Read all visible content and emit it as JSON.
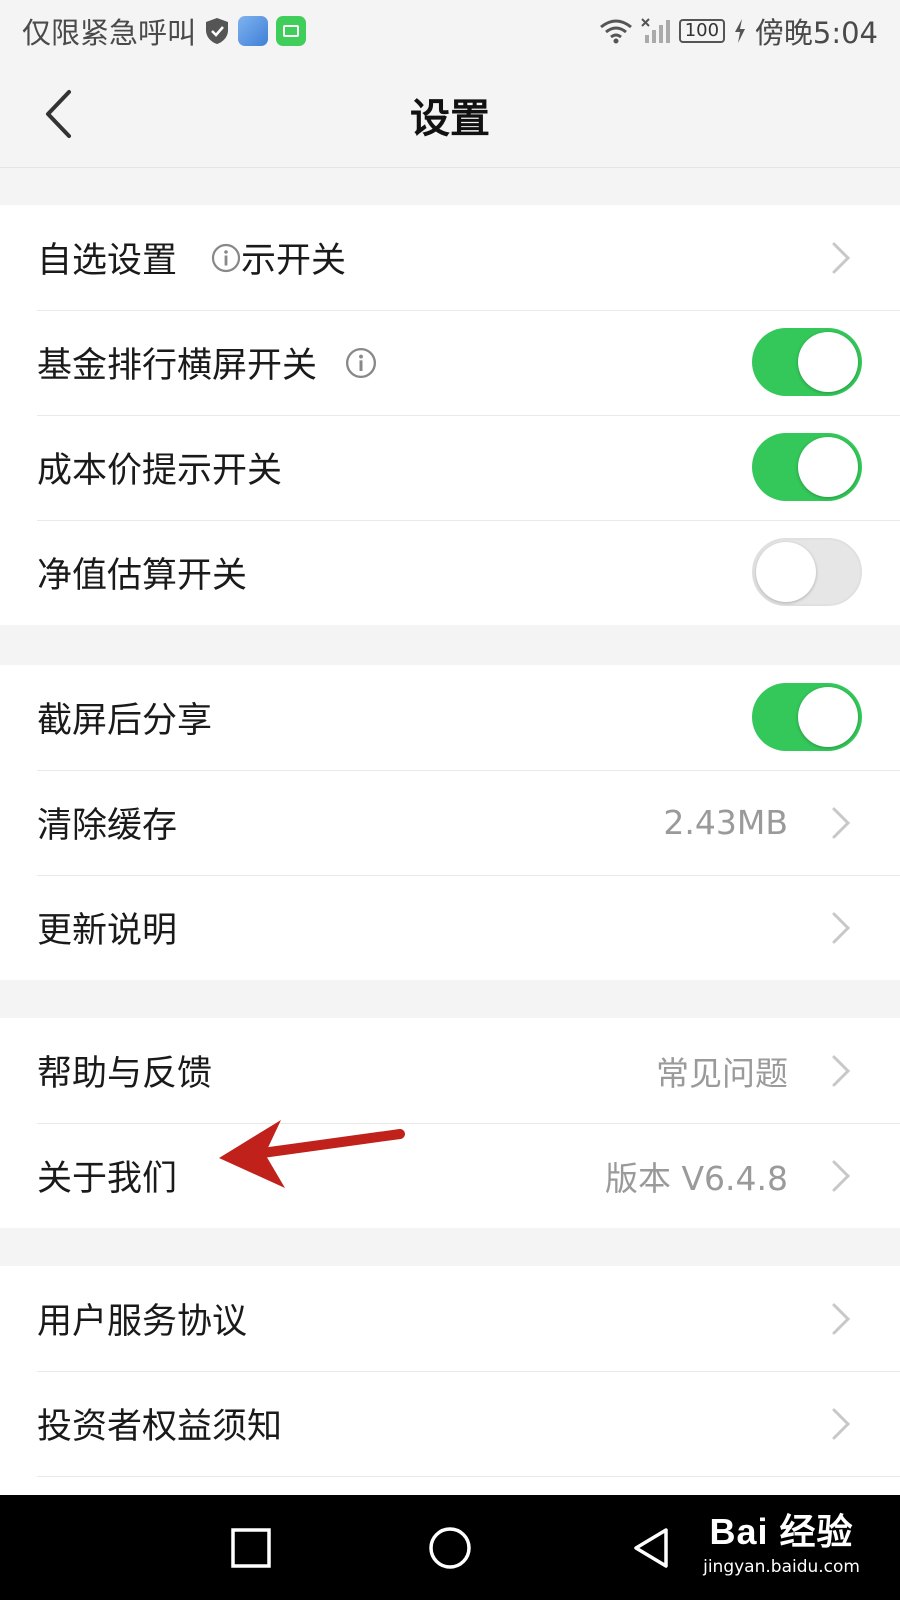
{
  "status_bar": {
    "carrier": "仅限紧急呼叫",
    "battery": "100",
    "time": "傍晚5:04"
  },
  "header": {
    "title": "设置"
  },
  "sections": [
    {
      "rows": [
        {
          "label": "自选设置",
          "label_suffix": "示开关",
          "type": "link"
        },
        {
          "label": "基金排行横屏开关",
          "type": "toggle",
          "on": true
        },
        {
          "label": "成本价提示开关",
          "type": "toggle",
          "on": true
        },
        {
          "label": "净值估算开关",
          "type": "toggle",
          "on": false
        }
      ]
    },
    {
      "rows": [
        {
          "label": "截屏后分享",
          "type": "toggle",
          "on": true
        },
        {
          "label": "清除缓存",
          "value": "2.43MB",
          "type": "link"
        },
        {
          "label": "更新说明",
          "type": "link"
        }
      ]
    },
    {
      "rows": [
        {
          "label": "帮助与反馈",
          "value": "常见问题",
          "type": "link"
        },
        {
          "label": "关于我们",
          "value": "版本 V6.4.8",
          "type": "link"
        }
      ]
    },
    {
      "rows": [
        {
          "label": "用户服务协议",
          "type": "link"
        },
        {
          "label": "投资者权益须知",
          "type": "link"
        }
      ]
    }
  ],
  "watermark": {
    "logo": "Bai 经验",
    "url": "jingyan.baidu.com"
  },
  "colors": {
    "toggle_on": "#34c759",
    "toggle_off": "#e6e6e6",
    "annotation_arrow": "#c0211a",
    "section_bg": "#ffffff",
    "page_bg": "#f4f4f4"
  }
}
